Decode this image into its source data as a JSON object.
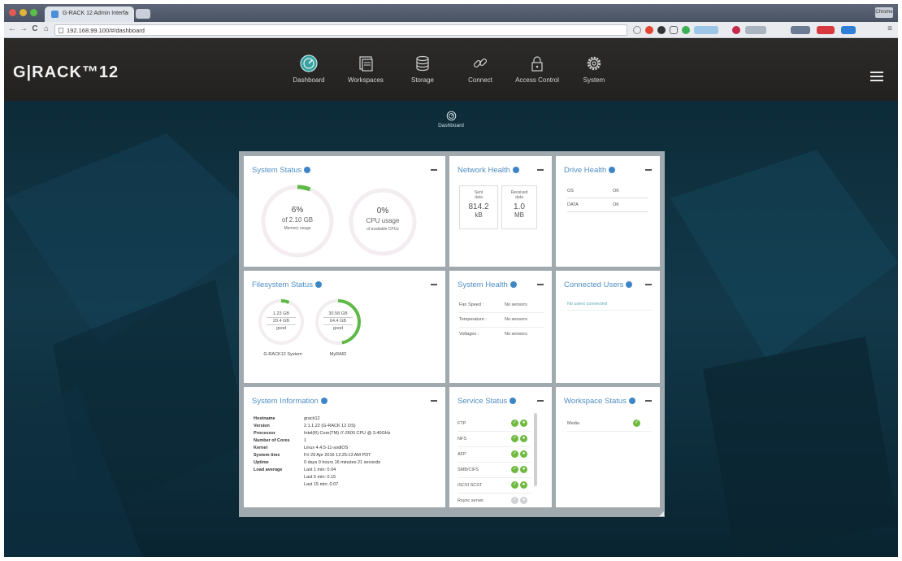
{
  "browser": {
    "tab_title": "G-RACK 12 Admin Interfa",
    "tab_close": "×",
    "url": "192.168.99.100/#/dashboard",
    "window_button": "Chrome",
    "back": "←",
    "forward": "→",
    "reload": "C",
    "home": "⌂",
    "menu": "≡"
  },
  "app": {
    "logo": "G|RACK™12",
    "nav": [
      {
        "label": "Dashboard",
        "icon": "gauge-icon"
      },
      {
        "label": "Workspaces",
        "icon": "folders-icon"
      },
      {
        "label": "Storage",
        "icon": "database-icon"
      },
      {
        "label": "Connect",
        "icon": "link-icon"
      },
      {
        "label": "Access Control",
        "icon": "lock-icon"
      },
      {
        "label": "System",
        "icon": "gear-icon"
      }
    ],
    "breadcrumb": "Dashboard"
  },
  "widgets": {
    "system_status": {
      "title": "System Status",
      "memory": {
        "percent": "6%",
        "value": "of 2.10 GB",
        "label": "Memory usage",
        "fraction": 0.06
      },
      "cpu": {
        "percent": "0%",
        "value": "CPU usage",
        "label": "of available CPUs",
        "fraction": 0.0
      }
    },
    "network_health": {
      "title": "Network Health",
      "sent": {
        "label1": "Sent",
        "label2": "data",
        "value1": "814.2",
        "value2": "kB"
      },
      "received": {
        "label1": "Received",
        "label2": "data",
        "value1": "1.0",
        "value2": "MB"
      }
    },
    "drive_health": {
      "title": "Drive Health",
      "rows": [
        {
          "name": "OS",
          "status": "OK"
        },
        {
          "name": "DATA",
          "status": "OK"
        }
      ]
    },
    "filesystem_status": {
      "title": "Filesystem Status",
      "volumes": [
        {
          "used": "1.23 GB",
          "total": "20.4 GB",
          "state": "good",
          "name": "G-RACK12 System",
          "fraction": 0.06
        },
        {
          "used": "30.58 GB",
          "total": "64.4 GB",
          "state": "good",
          "name": "MyRAID",
          "fraction": 0.47
        }
      ]
    },
    "system_health": {
      "title": "System Health",
      "rows": [
        {
          "key": "Fan Speed :",
          "value": "No sensors"
        },
        {
          "key": "Temperature :",
          "value": "No sensors"
        },
        {
          "key": "Voltages :",
          "value": "No sensors"
        }
      ]
    },
    "connected_users": {
      "title": "Connected Users",
      "empty": "No users connected"
    },
    "system_information": {
      "title": "System Information",
      "rows": [
        {
          "key": "Hostname",
          "value": "grack12"
        },
        {
          "key": "Version",
          "value": "2.1.1.22 (G-RACK 12 OS)"
        },
        {
          "key": "Processor",
          "value": "Intel(R) Core(TM) i7-2600 CPU @ 3.40GHz"
        },
        {
          "key": "Number of Cores",
          "value": "1"
        },
        {
          "key": "Kernel",
          "value": "Linux 4.4.5-11-sodiOS"
        },
        {
          "key": "System time",
          "value": "Fri 29 Apr 2016 12:25:13 AM PDT"
        },
        {
          "key": "Uptime",
          "value": "0 days 0 hours 16 minutes 21 seconds"
        },
        {
          "key": "Load average",
          "value": "Last 1 min: 0.04"
        },
        {
          "key": "",
          "value": "Last 5 min: 0.15"
        },
        {
          "key": "",
          "value": "Last 15 min: 0.07"
        }
      ]
    },
    "service_status": {
      "title": "Service Status",
      "rows": [
        {
          "name": "FTP",
          "active": true
        },
        {
          "name": "NFS",
          "active": true
        },
        {
          "name": "AFP",
          "active": true
        },
        {
          "name": "SMB/CIFS",
          "active": true
        },
        {
          "name": "iSCSI SCST",
          "active": true
        },
        {
          "name": "Rsync server",
          "active": false
        }
      ]
    },
    "workspace_status": {
      "title": "Workspace Status",
      "rows": [
        {
          "name": "Media",
          "active": true
        }
      ]
    }
  },
  "colors": {
    "accent": "#4f8ec2",
    "ok_green": "#6fba3e",
    "ring_track": "#f2eaf0",
    "header_bg": "#262524",
    "page_bg": "#0f3344"
  }
}
